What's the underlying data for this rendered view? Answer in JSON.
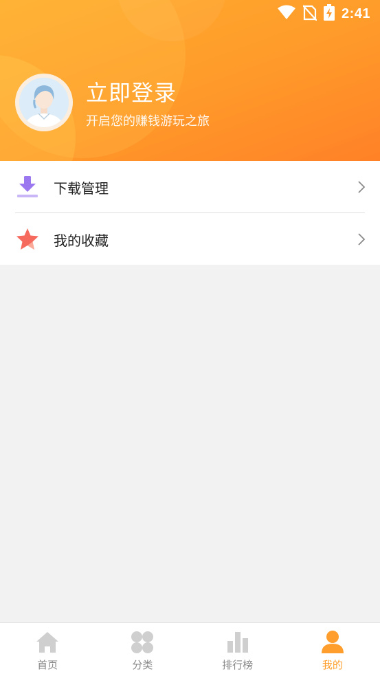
{
  "status_bar": {
    "time": "2:41",
    "icons": [
      "wifi-icon",
      "no-sim-icon",
      "battery-charging-icon"
    ]
  },
  "profile": {
    "title": "立即登录",
    "subtitle": "开启您的赚钱游玩之旅",
    "avatar_icon": "default-user-avatar"
  },
  "menu": {
    "items": [
      {
        "label": "下载管理",
        "icon": "download-icon"
      },
      {
        "label": "我的收藏",
        "icon": "star-icon"
      }
    ]
  },
  "bottom_nav": {
    "items": [
      {
        "label": "首页",
        "icon": "home-icon",
        "active": false
      },
      {
        "label": "分类",
        "icon": "category-grid-icon",
        "active": false
      },
      {
        "label": "排行榜",
        "icon": "bar-chart-icon",
        "active": false
      },
      {
        "label": "我的",
        "icon": "person-icon",
        "active": true
      }
    ]
  },
  "colors": {
    "accent": "#ff9e2c",
    "header_gradient_start": "#ffad2e",
    "header_gradient_end": "#ff8127",
    "inactive_icon": "#cfcfcf",
    "download_icon": "#9b77f0",
    "star_icon": "#f66a5e"
  }
}
